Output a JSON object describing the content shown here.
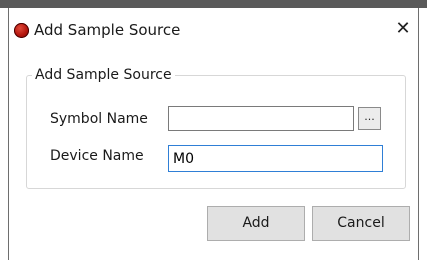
{
  "window": {
    "title": "Add Sample Source",
    "close_glyph": "✕"
  },
  "group": {
    "label": "Add Sample Source"
  },
  "fields": {
    "symbol_name": {
      "label": "Symbol Name",
      "value": "",
      "browse_label": "..."
    },
    "device_name": {
      "label": "Device Name",
      "value": "M0"
    }
  },
  "buttons": {
    "add": "Add",
    "cancel": "Cancel"
  },
  "icons": {
    "title_icon": "red-record-icon",
    "close": "close-icon"
  },
  "colors": {
    "focus_border": "#2f7fd6",
    "button_bg": "#e1e1e1"
  }
}
